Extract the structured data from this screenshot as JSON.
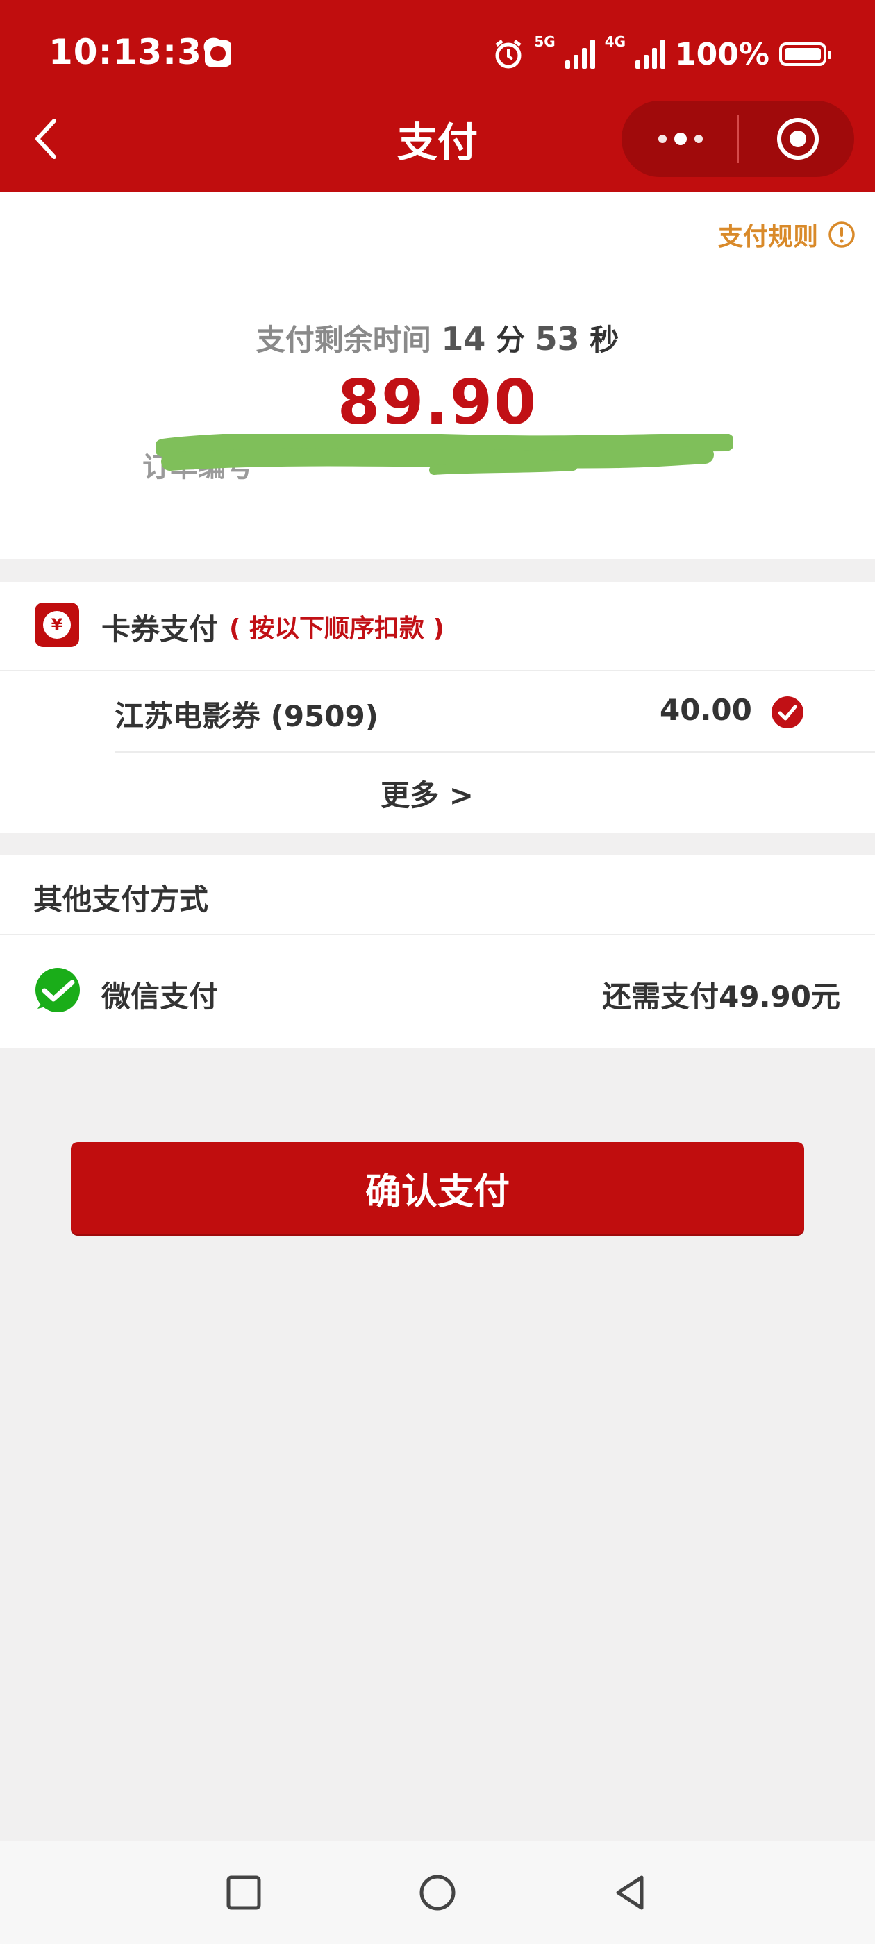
{
  "status_bar": {
    "time": "10:13:39",
    "net1": "5G",
    "net2": "4G",
    "battery": "100%"
  },
  "header": {
    "title": "支付"
  },
  "rules": {
    "label": "支付规则"
  },
  "countdown": {
    "label": "支付剩余时间",
    "minutes": "14",
    "minutes_unit": "分",
    "seconds": "53",
    "seconds_unit": "秒"
  },
  "amount": "89.90",
  "order_no": "订单编号",
  "card_pay": {
    "title": "卡券支付",
    "hint": "( 按以下顺序扣款 )",
    "coupon_name": "江苏电影券 (9509)",
    "coupon_amount": "40.00",
    "more": "更多 >"
  },
  "other_pay": {
    "title": "其他支付方式",
    "wechat_label": "微信支付",
    "remain": "还需支付49.90元"
  },
  "confirm": "确认支付",
  "colors": {
    "brand_red": "#c00d0e",
    "rule_orange": "#d98a2a",
    "wechat_green": "#1aad19"
  }
}
